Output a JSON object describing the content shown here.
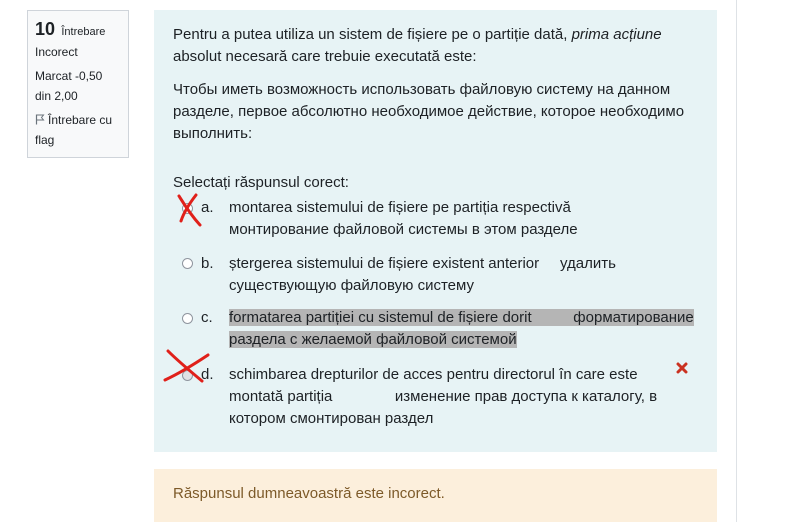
{
  "info": {
    "number": "10",
    "question_word": "Întrebare",
    "state": "Incorect",
    "grade": "Marcat -0,50 din 2,00",
    "flag_label": "Întrebare cu flag"
  },
  "question": {
    "text_ro_before": "Pentru a putea utiliza un sistem de fișiere pe o partiție dată, ",
    "text_ro_emph": "prima acțiune",
    "text_ro_after": " absolut necesară care trebuie executată este:",
    "text_ru": "Чтобы иметь возможность использовать файловую систему на данном разделе, первое абсолютно необходимое действие, которое необходимо выполнить:",
    "prompt": "Selectați răspunsul corect:"
  },
  "answers": [
    {
      "letter": "a.",
      "line1": "montarea sistemului de fișiere pe partiția respectivă",
      "line2": "монтирование файловой системы в этом разделе"
    },
    {
      "letter": "b.",
      "line1": "ștergerea sistemului de fișiere existent anterior     удалить",
      "line2": "существующую файловую систему"
    },
    {
      "letter": "c.",
      "line1": "formatarea partiției cu sistemul de fișiere dorit          форматирование",
      "line2": "раздела с желаемой файловой системой"
    },
    {
      "letter": "d.",
      "line1": "schimbarea drepturilor de acces pentru directorul în care este",
      "line2": "montată partiția               изменение прав доступа к каталогу, в",
      "line3": "котором смонтирован раздел"
    }
  ],
  "feedback": "Răspunsul dumneavoastră este incorect.",
  "colors": {
    "question_bg": "#e7f3f5",
    "feedback_bg": "#fcefdc",
    "feedback_text": "#7d5a29",
    "incorrect_mark": "#ca3120",
    "handwritten_x": "#e0201a",
    "highlight": "#b5b5b5"
  },
  "icons": [
    "flag-icon",
    "incorrect-icon",
    "handwritten-x-mark"
  ]
}
